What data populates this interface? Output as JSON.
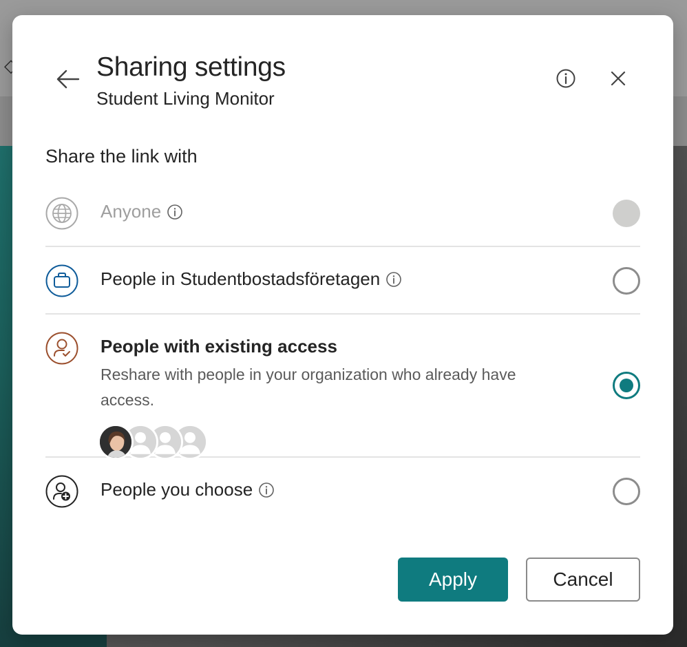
{
  "dialog": {
    "title": "Sharing settings",
    "subtitle": "Student Living Monitor",
    "section_heading": "Share the link with"
  },
  "options": [
    {
      "label": "Anyone",
      "icon": "globe-icon",
      "state": "disabled"
    },
    {
      "label": "People in Studentbostadsföretagen",
      "icon": "briefcase-icon",
      "state": "unselected"
    },
    {
      "label": "People with existing access",
      "description": "Reshare with people in your organization who already have access.",
      "icon": "person-check-icon",
      "state": "selected"
    },
    {
      "label": "People you choose",
      "icon": "person-add-icon",
      "state": "unselected"
    }
  ],
  "buttons": {
    "apply": "Apply",
    "cancel": "Cancel"
  },
  "colors": {
    "accent": "#0f7b7f",
    "org_icon": "#0f5c9a",
    "access_icon": "#9b4f2d",
    "disabled_text": "#9e9e9e"
  }
}
